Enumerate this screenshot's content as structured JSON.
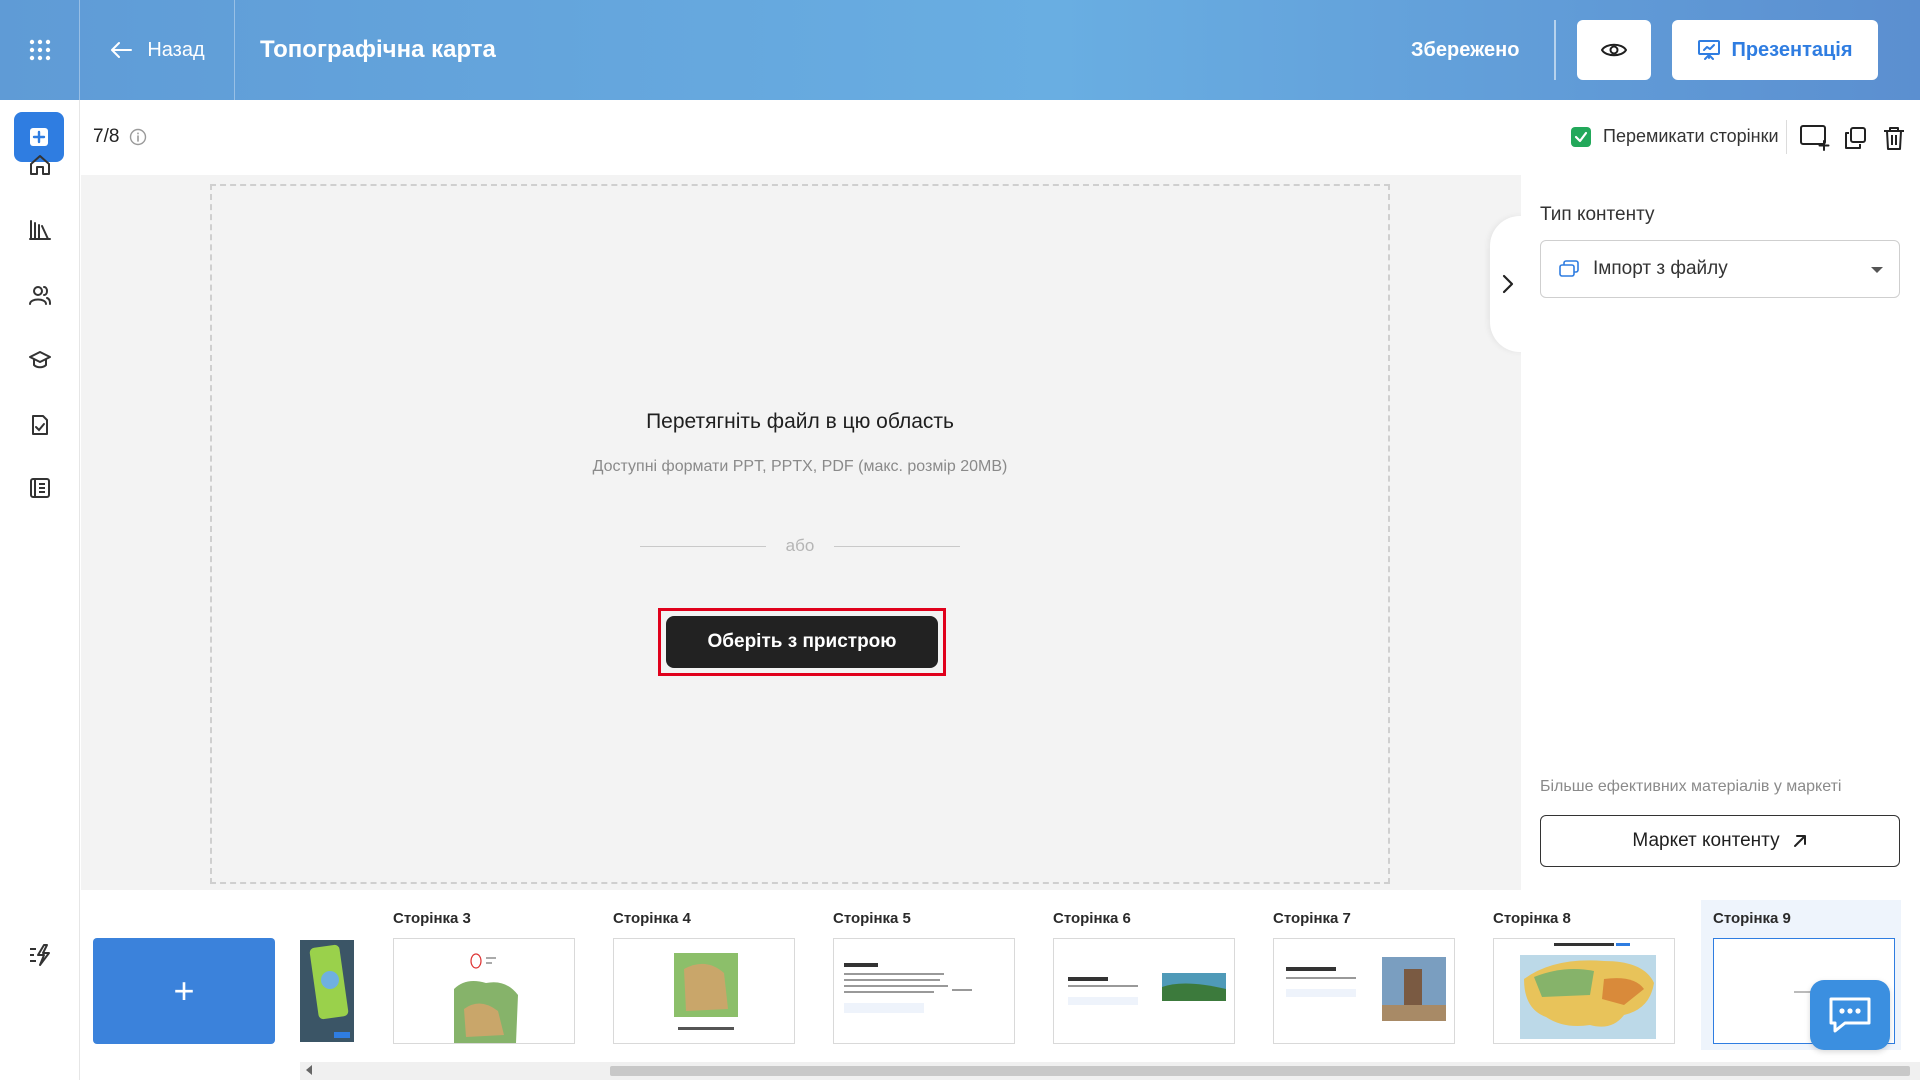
{
  "header": {
    "back_label": "Назад",
    "title": "Топографічна карта",
    "saved_status": "Збережено",
    "presentation_label": "Презентація"
  },
  "toolbar": {
    "page_counter": "7/8",
    "switch_pages_label": "Перемикати сторінки",
    "switch_pages_checked": true
  },
  "dropzone": {
    "title": "Перетягніть файл в цю область",
    "formats": "Доступні формати PPT, PPTX, PDF (макс. розмір 20MB)",
    "or": "або",
    "choose_button": "Оберіть з пристрою"
  },
  "right_panel": {
    "content_type_label": "Тип контенту",
    "content_type_value": "Імпорт з файлу",
    "market_note": "Більше ефективних матеріалів у маркеті",
    "market_button": "Маркет контенту"
  },
  "pages": [
    {
      "label": "Сторінка 3"
    },
    {
      "label": "Сторінка 4"
    },
    {
      "label": "Сторінка 5"
    },
    {
      "label": "Сторінка 6"
    },
    {
      "label": "Сторінка 7"
    },
    {
      "label": "Сторінка 8"
    },
    {
      "label": "Сторінка 9",
      "active": true
    }
  ],
  "colors": {
    "accent": "#2f7de1",
    "header_gradient_start": "#5f9bd6",
    "highlight": "#e0001b",
    "check_green": "#22a85a"
  }
}
